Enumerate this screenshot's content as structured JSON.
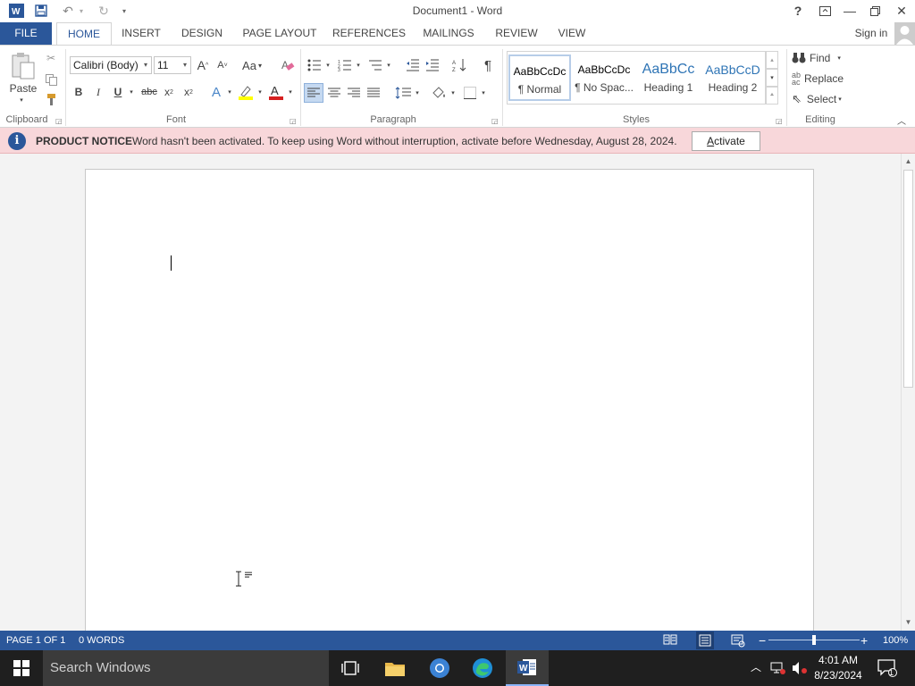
{
  "window": {
    "title": "Document1 - Word"
  },
  "quick_access": {
    "word_icon": "word-icon",
    "save": "save-icon",
    "undo": "undo-icon",
    "redo": "redo-icon",
    "customize": "customize-icon"
  },
  "window_controls": {
    "help": "?",
    "ribbon_display": "ribbon-display-icon",
    "minimize": "—",
    "restore": "restore-icon",
    "close": "✕"
  },
  "tabs": [
    {
      "label": "FILE"
    },
    {
      "label": "HOME"
    },
    {
      "label": "INSERT"
    },
    {
      "label": "DESIGN"
    },
    {
      "label": "PAGE LAYOUT"
    },
    {
      "label": "REFERENCES"
    },
    {
      "label": "MAILINGS"
    },
    {
      "label": "REVIEW"
    },
    {
      "label": "VIEW"
    }
  ],
  "account": {
    "sign_in": "Sign in"
  },
  "ribbon": {
    "clipboard": {
      "label": "Clipboard",
      "paste": "Paste"
    },
    "font": {
      "label": "Font",
      "family": "Calibri (Body)",
      "size": "11",
      "grow": "A",
      "shrink": "A",
      "change_case": "Aa",
      "bold": "B",
      "italic": "I",
      "underline": "U",
      "strike": "abc",
      "subscript": "x",
      "superscript": "x",
      "effects": "A",
      "font_color": "A"
    },
    "paragraph": {
      "label": "Paragraph"
    },
    "styles": {
      "label": "Styles",
      "items": [
        {
          "preview": "AaBbCcDc",
          "name": "¶ Normal"
        },
        {
          "preview": "AaBbCcDc",
          "name": "¶ No Spac..."
        },
        {
          "preview": "AaBbCc",
          "name": "Heading 1"
        },
        {
          "preview": "AaBbCcD",
          "name": "Heading 2"
        }
      ]
    },
    "editing": {
      "label": "Editing",
      "find": "Find",
      "replace": "Replace",
      "select": "Select"
    }
  },
  "notice": {
    "title": "PRODUCT NOTICE",
    "message": "Word hasn't been activated. To keep using Word without interruption, activate before Wednesday, August 28, 2024.",
    "button": "Activate"
  },
  "status": {
    "page": "PAGE 1 OF 1",
    "words": "0 WORDS",
    "zoom": "100%",
    "zoom_level": 0.5
  },
  "taskbar": {
    "search_placeholder": "Search Windows",
    "time": "4:01 AM",
    "date": "8/23/2024",
    "notification_count": "1"
  },
  "colors": {
    "accent": "#2b579a",
    "notice_bg": "#f8d7da",
    "taskbar": "#1f1f1f"
  }
}
